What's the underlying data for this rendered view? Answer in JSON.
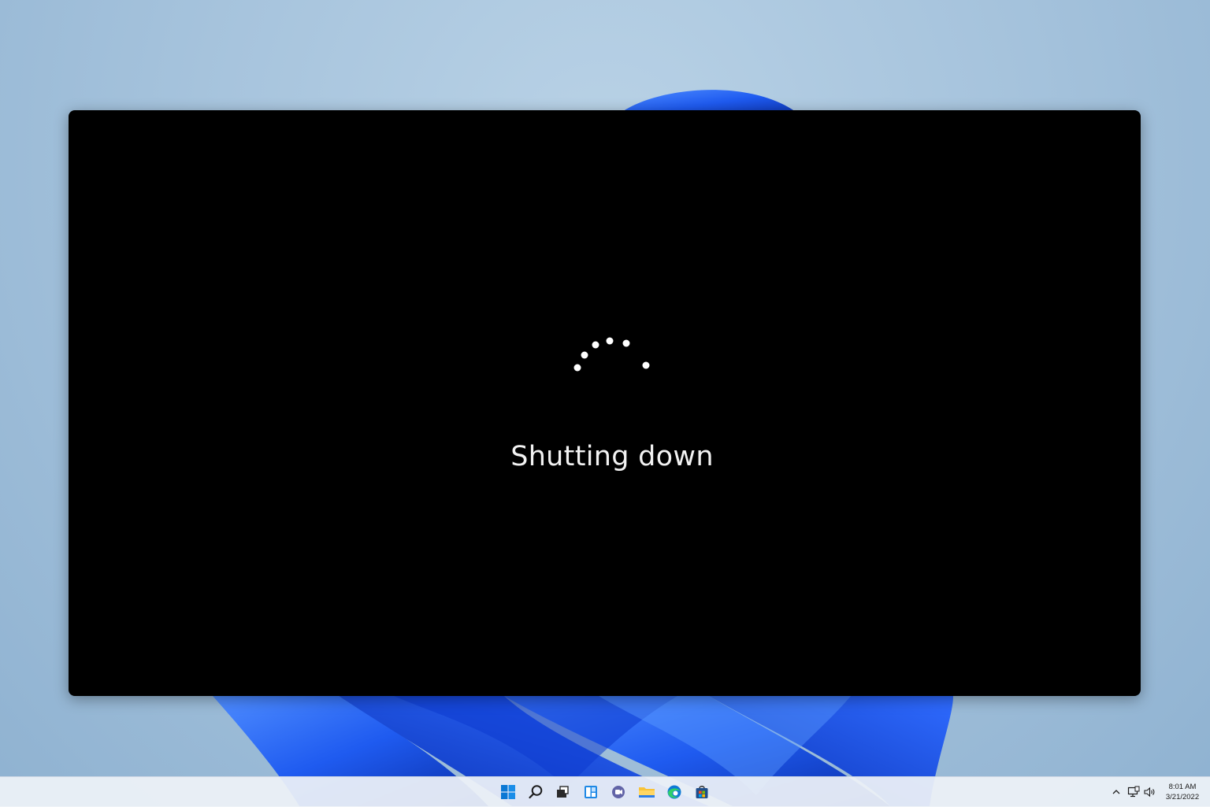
{
  "screen": {
    "status_text": "Shutting down"
  },
  "taskbar": {
    "apps": [
      {
        "name": "start-button",
        "icon": "windows-logo-icon"
      },
      {
        "name": "search-button",
        "icon": "search-icon"
      },
      {
        "name": "task-view-button",
        "icon": "task-view-icon"
      },
      {
        "name": "widgets-button",
        "icon": "widgets-icon"
      },
      {
        "name": "chat-button",
        "icon": "teams-chat-icon"
      },
      {
        "name": "file-explorer-button",
        "icon": "folder-icon"
      },
      {
        "name": "edge-button",
        "icon": "edge-browser-icon"
      },
      {
        "name": "store-button",
        "icon": "store-icon"
      }
    ],
    "tray": {
      "icons": [
        "chevron-up-icon",
        "network-icon",
        "volume-icon"
      ],
      "time": "8:01 AM",
      "date": "3/21/2022"
    }
  },
  "colors": {
    "overlay": "#000000",
    "status_text": "#f2f2f2",
    "accent": "#0067c0",
    "wallpaper_bloom": "#1f5bf0",
    "desktop_background": "#a7c4dd"
  }
}
